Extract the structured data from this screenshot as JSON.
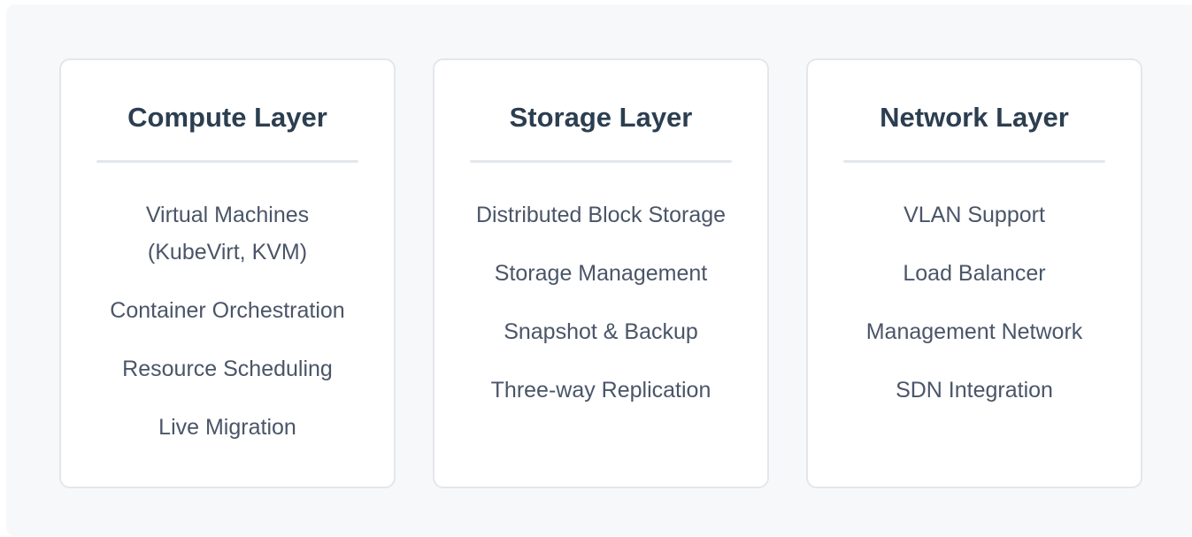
{
  "layers": [
    {
      "title": "Compute Layer",
      "items": [
        "Virtual Machines (KubeVirt, KVM)",
        "Container Orchestration",
        "Resource Scheduling",
        "Live Migration"
      ]
    },
    {
      "title": "Storage Layer",
      "items": [
        "Distributed Block Storage",
        "Storage Management",
        "Snapshot & Backup",
        "Three-way Replication"
      ]
    },
    {
      "title": "Network Layer",
      "items": [
        "VLAN Support",
        "Load Balancer",
        "Management Network",
        "SDN Integration"
      ]
    }
  ]
}
